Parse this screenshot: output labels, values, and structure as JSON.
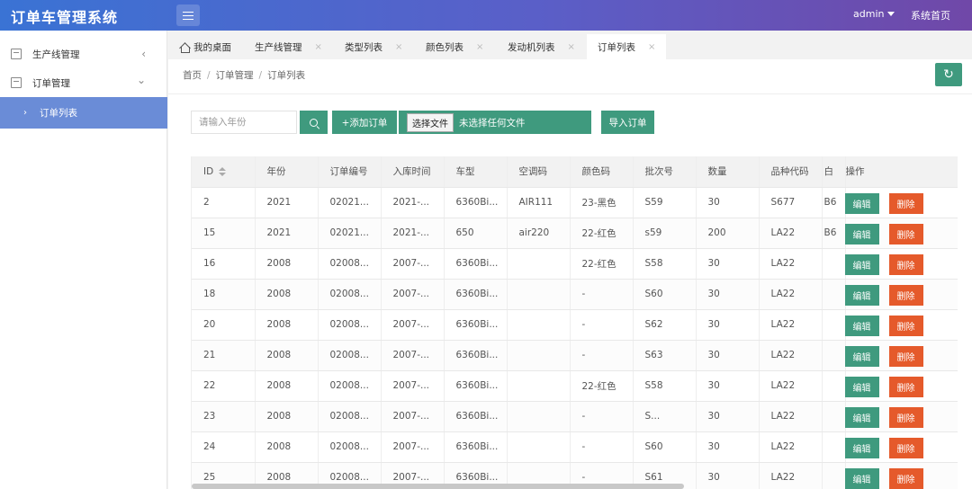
{
  "app": {
    "title": "订单车管理系统",
    "user": "admin",
    "home_link": "系统首页"
  },
  "sidebar": {
    "items": [
      {
        "label": "生产线管理",
        "arrow": "‹"
      },
      {
        "label": "订单管理",
        "arrow": "⌄"
      },
      {
        "label": "订单列表"
      }
    ]
  },
  "tabs": [
    {
      "label": "我的桌面"
    },
    {
      "label": "生产线管理"
    },
    {
      "label": "类型列表"
    },
    {
      "label": "颜色列表"
    },
    {
      "label": "发动机列表"
    },
    {
      "label": "订单列表"
    }
  ],
  "breadcrumb": {
    "items": [
      "首页",
      "订单管理",
      "订单列表"
    ],
    "separator": "/"
  },
  "toolbar": {
    "search_placeholder": "请输入年份",
    "add_label": "+添加订单",
    "file_button": "选择文件",
    "file_status": "未选择任何文件",
    "import_label": "导入订单"
  },
  "table": {
    "headers": [
      "ID",
      "年份",
      "订单编号",
      "入库时间",
      "车型",
      "空调码",
      "颜色码",
      "批次号",
      "数量",
      "品种代码",
      "白",
      "操作"
    ],
    "edit_label": "编辑",
    "delete_label": "删除",
    "rows": [
      {
        "id": "2",
        "year": "2021",
        "order_no": "02021...",
        "in_time": "2021-...",
        "model": "6360Bi...",
        "ac": "AIR111",
        "color": "23-黑色",
        "batch": "S59",
        "qty": "30",
        "variety": "S677",
        "white": "B6"
      },
      {
        "id": "15",
        "year": "2021",
        "order_no": "02021...",
        "in_time": "2021-...",
        "model": "650",
        "ac": "air220",
        "color": "22-红色",
        "batch": "s59",
        "qty": "200",
        "variety": "LA22",
        "white": "B6"
      },
      {
        "id": "16",
        "year": "2008",
        "order_no": "02008...",
        "in_time": "2007-...",
        "model": "6360Bi...",
        "ac": "",
        "color": "22-红色",
        "batch": "S58",
        "qty": "30",
        "variety": "LA22",
        "white": ""
      },
      {
        "id": "18",
        "year": "2008",
        "order_no": "02008...",
        "in_time": "2007-...",
        "model": "6360Bi...",
        "ac": "",
        "color": "-",
        "batch": "S60",
        "qty": "30",
        "variety": "LA22",
        "white": ""
      },
      {
        "id": "20",
        "year": "2008",
        "order_no": "02008...",
        "in_time": "2007-...",
        "model": "6360Bi...",
        "ac": "",
        "color": "-",
        "batch": "S62",
        "qty": "30",
        "variety": "LA22",
        "white": ""
      },
      {
        "id": "21",
        "year": "2008",
        "order_no": "02008...",
        "in_time": "2007-...",
        "model": "6360Bi...",
        "ac": "",
        "color": "-",
        "batch": "S63",
        "qty": "30",
        "variety": "LA22",
        "white": ""
      },
      {
        "id": "22",
        "year": "2008",
        "order_no": "02008...",
        "in_time": "2007-...",
        "model": "6360Bi...",
        "ac": "",
        "color": "22-红色",
        "batch": "S58",
        "qty": "30",
        "variety": "LA22",
        "white": ""
      },
      {
        "id": "23",
        "year": "2008",
        "order_no": "02008...",
        "in_time": "2007-...",
        "model": "6360Bi...",
        "ac": "",
        "color": "-",
        "batch": "S...",
        "qty": "30",
        "variety": "LA22",
        "white": ""
      },
      {
        "id": "24",
        "year": "2008",
        "order_no": "02008...",
        "in_time": "2007-...",
        "model": "6360Bi...",
        "ac": "",
        "color": "-",
        "batch": "S60",
        "qty": "30",
        "variety": "LA22",
        "white": ""
      },
      {
        "id": "25",
        "year": "2008",
        "order_no": "02008...",
        "in_time": "2007-...",
        "model": "6360Bi...",
        "ac": "",
        "color": "-",
        "batch": "S61",
        "qty": "30",
        "variety": "LA22",
        "white": ""
      }
    ]
  },
  "colors": {
    "accent_green": "#3f9a7e",
    "danger_orange": "#e55a2b",
    "header_gradient": [
      "#3a73d4",
      "#7048a8"
    ],
    "sidebar_active": "#6a8cd7"
  }
}
